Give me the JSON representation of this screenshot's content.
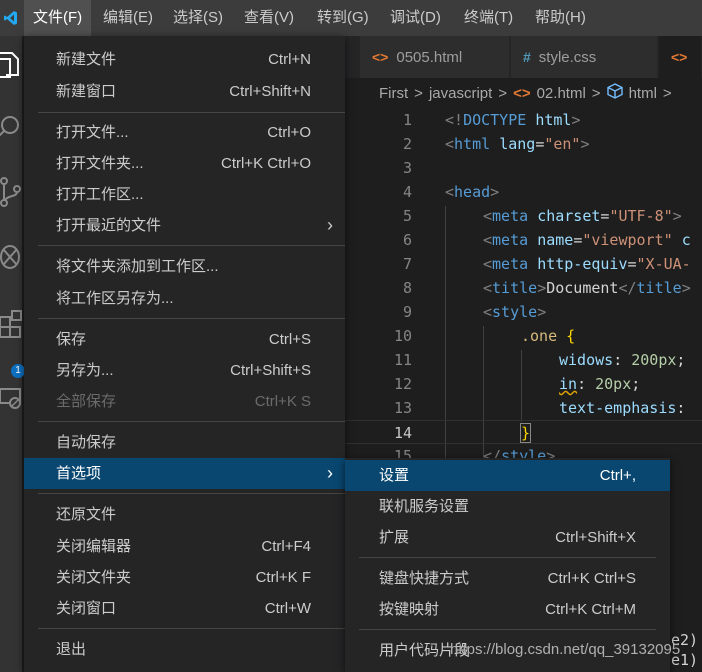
{
  "menubar": {
    "items": [
      "文件(F)",
      "编辑(E)",
      "选择(S)",
      "查看(V)",
      "转到(G)",
      "调试(D)",
      "终端(T)",
      "帮助(H)"
    ]
  },
  "tabs": [
    {
      "label": "0505.html",
      "icon": "<>"
    },
    {
      "label": "style.css",
      "icon": "#"
    },
    {
      "label": "",
      "icon": "<>"
    }
  ],
  "breadcrumb": [
    "First",
    "javascript",
    "02.html",
    "html"
  ],
  "editor": {
    "lines": [
      {
        "n": "1"
      },
      {
        "n": "2"
      },
      {
        "n": "3"
      },
      {
        "n": "4"
      },
      {
        "n": "5"
      },
      {
        "n": "6"
      },
      {
        "n": "7"
      },
      {
        "n": "8"
      },
      {
        "n": "9"
      },
      {
        "n": "10"
      },
      {
        "n": "11"
      },
      {
        "n": "12"
      },
      {
        "n": "13"
      },
      {
        "n": "14"
      },
      {
        "n": "15"
      }
    ]
  },
  "file_menu": {
    "items": [
      {
        "label": "新建文件",
        "shortcut": "Ctrl+N"
      },
      {
        "label": "新建窗口",
        "shortcut": "Ctrl+Shift+N"
      },
      {
        "label": "打开文件...",
        "shortcut": "Ctrl+O"
      },
      {
        "label": "打开文件夹...",
        "shortcut": "Ctrl+K Ctrl+O"
      },
      {
        "label": "打开工作区...",
        "shortcut": ""
      },
      {
        "label": "打开最近的文件",
        "shortcut": ""
      },
      {
        "label": "将文件夹添加到工作区...",
        "shortcut": ""
      },
      {
        "label": "将工作区另存为...",
        "shortcut": ""
      },
      {
        "label": "保存",
        "shortcut": "Ctrl+S"
      },
      {
        "label": "另存为...",
        "shortcut": "Ctrl+Shift+S"
      },
      {
        "label": "全部保存",
        "shortcut": "Ctrl+K S"
      },
      {
        "label": "自动保存",
        "shortcut": ""
      },
      {
        "label": "首选项",
        "shortcut": ""
      },
      {
        "label": "还原文件",
        "shortcut": ""
      },
      {
        "label": "关闭编辑器",
        "shortcut": "Ctrl+F4"
      },
      {
        "label": "关闭文件夹",
        "shortcut": "Ctrl+K F"
      },
      {
        "label": "关闭窗口",
        "shortcut": "Ctrl+W"
      },
      {
        "label": "退出",
        "shortcut": ""
      }
    ]
  },
  "preferences_submenu": {
    "items": [
      {
        "label": "设置",
        "shortcut": "Ctrl+,"
      },
      {
        "label": "联机服务设置",
        "shortcut": ""
      },
      {
        "label": "扩展",
        "shortcut": "Ctrl+Shift+X"
      },
      {
        "label": "键盘快捷方式",
        "shortcut": "Ctrl+K Ctrl+S"
      },
      {
        "label": "按键映射",
        "shortcut": "Ctrl+K Ctrl+M"
      },
      {
        "label": "用户代码片段",
        "shortcut": ""
      }
    ]
  },
  "activity_badge": "1",
  "watermark": "https://blog.csdn.net/qq_39132095",
  "colors": {
    "highlight": "#094771",
    "menu_bg": "#252526",
    "titlebar": "#3c3c3c"
  }
}
